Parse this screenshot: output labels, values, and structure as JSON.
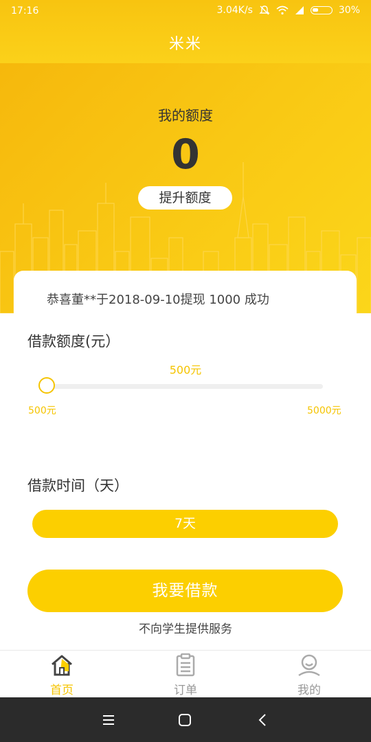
{
  "status_bar": {
    "time": "17:16",
    "network_speed": "3.04K/s",
    "battery": "30%"
  },
  "header": {
    "title": "米米"
  },
  "quota": {
    "label": "我的额度",
    "value": "0",
    "raise_button": "提升额度"
  },
  "notice": {
    "text": "恭喜董**于2018-09-10提现 1000 成功"
  },
  "loan_amount": {
    "title": "借款额度(元）",
    "current": "500元",
    "current_value": 500,
    "min_label": "500元",
    "max_label": "5000元",
    "min": 500,
    "max": 5000
  },
  "loan_term": {
    "title": "借款时间（天）",
    "selected": "7天"
  },
  "borrow_button": "我要借款",
  "disclaimer": "不向学生提供服务",
  "tabs": [
    {
      "label": "首页",
      "active": true
    },
    {
      "label": "订单",
      "active": false
    },
    {
      "label": "我的",
      "active": false
    }
  ],
  "colors": {
    "brand_yellow": "#fccf00",
    "accent_text": "#f5c400",
    "header_gradient_top": "#f8c410",
    "tab_inactive": "#999999"
  },
  "icons": {
    "home": "home-icon",
    "orders": "clipboard-icon",
    "mine": "user-icon"
  }
}
